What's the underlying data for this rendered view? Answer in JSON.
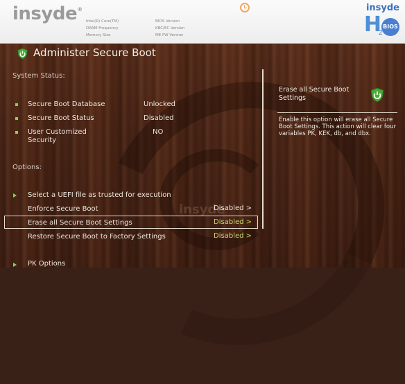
{
  "header": {
    "logo": "insyde",
    "logo_mark": "®",
    "info_labels": [
      "Intel(R) Core(TM)",
      "DRAM Frequency",
      "Memory Size"
    ],
    "info_right": [
      "BIOS Version",
      "KBC/EC Version",
      "ME FW Version"
    ],
    "brand_word": "insyde",
    "brand_h": "H",
    "brand_2": "2",
    "brand_bios": "BIOS"
  },
  "page": {
    "title": "Administer Secure Boot"
  },
  "system_status": {
    "heading": "System Status:",
    "rows": [
      {
        "label": "Secure Boot Database",
        "value": "Unlocked"
      },
      {
        "label": "Secure Boot Status",
        "value": "Disabled"
      },
      {
        "label": "User Customized Security",
        "value": "NO"
      }
    ]
  },
  "options": {
    "heading": "Options:",
    "items": [
      {
        "label": "Select a UEFI file as trusted for execution",
        "value": ""
      },
      {
        "label": "Enforce Secure Boot",
        "value": "Disabled >"
      },
      {
        "label": "Erase all Secure Boot Settings",
        "value": "Disabled >"
      },
      {
        "label": "Restore Secure Boot to Factory Settings",
        "value": "Disabled >"
      },
      {
        "label": "PK Options",
        "value": ""
      }
    ]
  },
  "help": {
    "title": "Erase all Secure Boot Settings",
    "text": "Enable this option will erase all Secure Boot Settings. This action will clear four variables PK, KEK, db, and dbx."
  },
  "watermark": "insyde",
  "colors": {
    "accent_green": "#7fd64f",
    "value_green": "#c8d86e",
    "brand_blue": "#4f8fd6"
  },
  "icons": [
    "clock-icon",
    "shield-power-icon"
  ]
}
